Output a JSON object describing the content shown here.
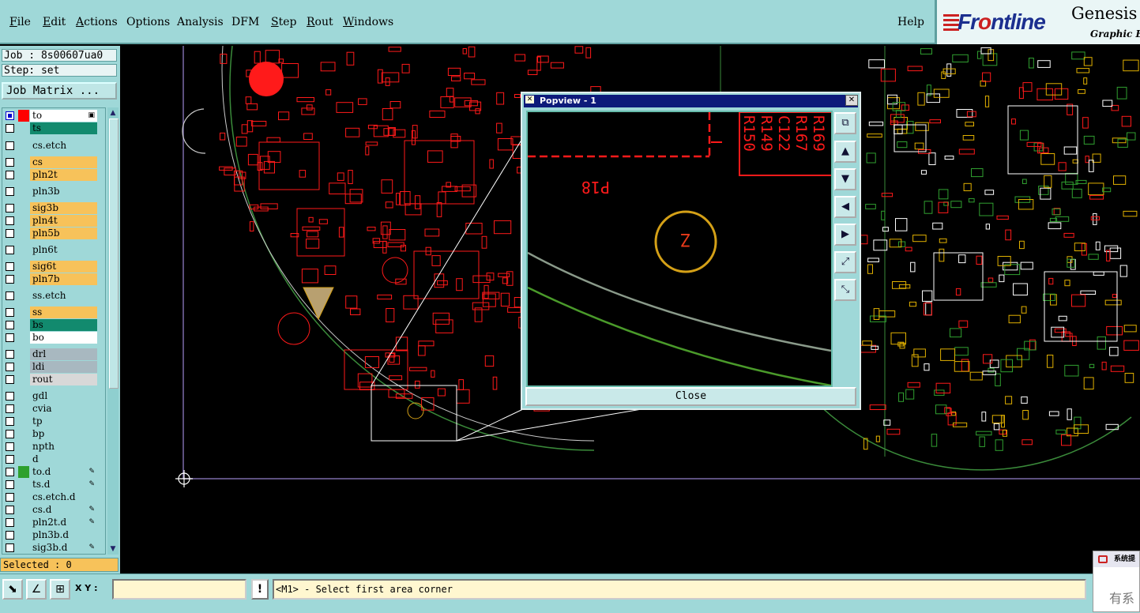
{
  "menu": {
    "items": [
      {
        "label": "File",
        "accel": "F"
      },
      {
        "label": "Edit",
        "accel": "E"
      },
      {
        "label": "Actions",
        "accel": "A"
      },
      {
        "label": "Options",
        "accel": ""
      },
      {
        "label": "Analysis",
        "accel": ""
      },
      {
        "label": "DFM",
        "accel": ""
      },
      {
        "label": "Step",
        "accel": "S"
      },
      {
        "label": "Rout",
        "accel": "R"
      },
      {
        "label": "Windows",
        "accel": "W"
      }
    ],
    "help": "Help"
  },
  "brand": {
    "name_front": "Fr",
    "name_rest": "ntline",
    "product": "Genesis",
    "tagline": "Graphic Ed"
  },
  "job": {
    "job_label": "Job : 8s00607ua0",
    "step_label": "Step: set",
    "matrix_button": "Job Matrix ..."
  },
  "layers": [
    {
      "name": "to",
      "color": "#ffffff",
      "swatch": "#ff0000",
      "checked": true,
      "flag": "▣"
    },
    {
      "name": "ts",
      "color": "#128a6e",
      "swatch": "",
      "checked": false,
      "flag": ""
    },
    {
      "name": "cs.etch",
      "color": "#9fd8d8",
      "swatch": "",
      "checked": false,
      "flag": ""
    },
    {
      "name": "cs",
      "color": "#f7c25a",
      "swatch": "",
      "checked": false,
      "flag": ""
    },
    {
      "name": "pln2t",
      "color": "#f7c25a",
      "swatch": "",
      "checked": false,
      "flag": ""
    },
    {
      "name": "pln3b",
      "color": "#9fd8d8",
      "swatch": "",
      "checked": false,
      "flag": ""
    },
    {
      "name": "sig3b",
      "color": "#f7c25a",
      "swatch": "",
      "checked": false,
      "flag": ""
    },
    {
      "name": "pln4t",
      "color": "#f7c25a",
      "swatch": "",
      "checked": false,
      "flag": ""
    },
    {
      "name": "pln5b",
      "color": "#f7c25a",
      "swatch": "",
      "checked": false,
      "flag": ""
    },
    {
      "name": "pln6t",
      "color": "#9fd8d8",
      "swatch": "",
      "checked": false,
      "flag": ""
    },
    {
      "name": "sig6t",
      "color": "#f7c25a",
      "swatch": "",
      "checked": false,
      "flag": ""
    },
    {
      "name": "pln7b",
      "color": "#f7c25a",
      "swatch": "",
      "checked": false,
      "flag": ""
    },
    {
      "name": "ss.etch",
      "color": "#9fd8d8",
      "swatch": "",
      "checked": false,
      "flag": ""
    },
    {
      "name": "ss",
      "color": "#f7c25a",
      "swatch": "",
      "checked": false,
      "flag": ""
    },
    {
      "name": "bs",
      "color": "#128a6e",
      "swatch": "",
      "checked": false,
      "flag": ""
    },
    {
      "name": "bo",
      "color": "#ffffff",
      "swatch": "",
      "checked": false,
      "flag": ""
    },
    {
      "name": "drl",
      "color": "#a8b8c0",
      "swatch": "",
      "checked": false,
      "flag": ""
    },
    {
      "name": "ldi",
      "color": "#a8b8c0",
      "swatch": "",
      "checked": false,
      "flag": ""
    },
    {
      "name": "rout",
      "color": "#d8d8d8",
      "swatch": "",
      "checked": false,
      "flag": ""
    },
    {
      "name": "gdl",
      "color": "#9fd8d8",
      "swatch": "",
      "checked": false,
      "flag": ""
    },
    {
      "name": "cvia",
      "color": "#9fd8d8",
      "swatch": "",
      "checked": false,
      "flag": ""
    },
    {
      "name": "tp",
      "color": "#9fd8d8",
      "swatch": "",
      "checked": false,
      "flag": ""
    },
    {
      "name": "bp",
      "color": "#9fd8d8",
      "swatch": "",
      "checked": false,
      "flag": ""
    },
    {
      "name": "npth",
      "color": "#9fd8d8",
      "swatch": "",
      "checked": false,
      "flag": ""
    },
    {
      "name": "d",
      "color": "#9fd8d8",
      "swatch": "",
      "checked": false,
      "flag": ""
    },
    {
      "name": "to.d",
      "color": "#9fd8d8",
      "swatch": "#2ea02e",
      "checked": false,
      "flag": "✎"
    },
    {
      "name": "ts.d",
      "color": "#9fd8d8",
      "swatch": "",
      "checked": false,
      "flag": "✎"
    },
    {
      "name": "cs.etch.d",
      "color": "#9fd8d8",
      "swatch": "",
      "checked": false,
      "flag": ""
    },
    {
      "name": "cs.d",
      "color": "#9fd8d8",
      "swatch": "",
      "checked": false,
      "flag": "✎"
    },
    {
      "name": "pln2t.d",
      "color": "#9fd8d8",
      "swatch": "",
      "checked": false,
      "flag": "✎"
    },
    {
      "name": "pln3b.d",
      "color": "#9fd8d8",
      "swatch": "",
      "checked": false,
      "flag": ""
    },
    {
      "name": "sig3b.d",
      "color": "#9fd8d8",
      "swatch": "",
      "checked": false,
      "flag": "✎"
    }
  ],
  "selected_label": "Selected : 0",
  "popview": {
    "title": "Popview - 1",
    "close_label": "Close",
    "labels": {
      "p18": "P18",
      "r169": "R169",
      "r167": "R167",
      "c122": "C122",
      "r149": "R149",
      "r150": "R150",
      "pin": "Z"
    },
    "tools": [
      "zoom-fit-icon",
      "pan-up-icon",
      "pan-down-icon",
      "pan-left-icon",
      "pan-right-icon",
      "zoom-in-icon",
      "zoom-out-icon"
    ]
  },
  "bottom": {
    "xy_label": "X Y :",
    "xy_value": "",
    "alert": "!",
    "prompt": "<M1> - Select first area corner"
  },
  "notification": {
    "title": "系统提",
    "body": "有系"
  },
  "colors": {
    "pcb_red": "#ff1a1a",
    "board_outline": "#7a6aa8",
    "ring": "#d4a017",
    "green_trace": "#4a9a2a",
    "grey_trace": "#8a9a8a"
  }
}
